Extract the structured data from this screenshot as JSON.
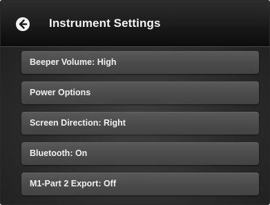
{
  "header": {
    "title": "Instrument Settings",
    "back_icon": "back-arrow-icon"
  },
  "menu": {
    "items": [
      {
        "label": "Beeper Volume: High"
      },
      {
        "label": "Power Options"
      },
      {
        "label": "Screen Direction: Right"
      },
      {
        "label": "Bluetooth: On"
      },
      {
        "label": "M1-Part 2 Export: Off"
      }
    ]
  },
  "colors": {
    "header_background": "#151515",
    "button_background": "#4b4b4b",
    "text": "#f0f0f0"
  }
}
